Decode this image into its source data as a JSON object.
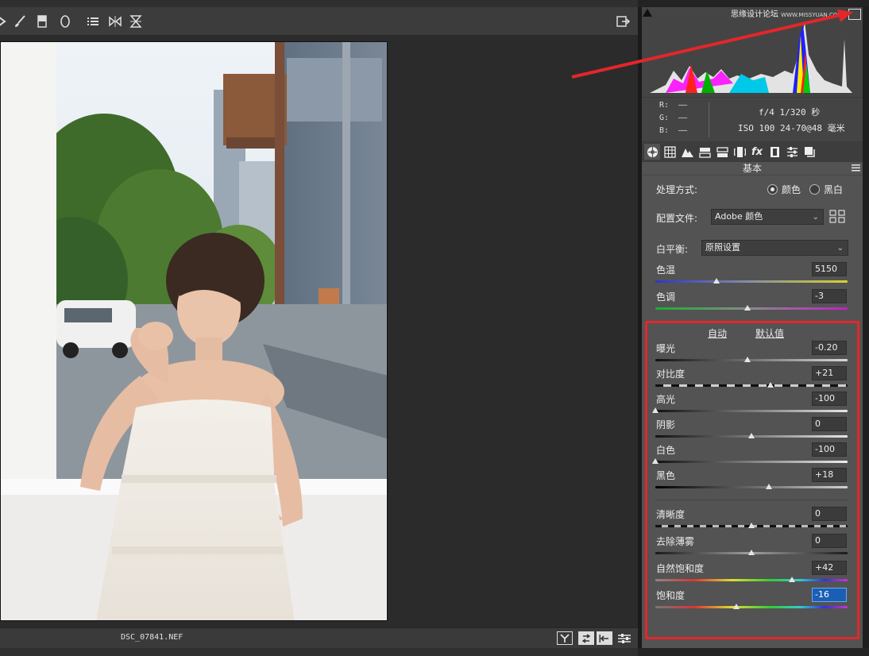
{
  "app": {
    "filename": "DSC_07841.NEF"
  },
  "histogram": {
    "watermark_text": "思缘设计论坛",
    "watermark_url": "WWW.MISSYUAN.COM"
  },
  "info": {
    "r_label": "R:",
    "g_label": "G:",
    "b_label": "B:",
    "r_value": "——",
    "g_value": "——",
    "b_value": "——",
    "exposure_line": "f/4  1/320 秒",
    "iso_line": "ISO 100  24-70@48 毫米"
  },
  "panel": {
    "section_title": "基本",
    "treatment_label": "处理方式:",
    "treatment_color": "颜色",
    "treatment_bw": "黑白",
    "profile_label": "配置文件:",
    "profile_value": "Adobe 颜色",
    "wb_label": "白平衡:",
    "wb_value": "原照设置",
    "auto_label": "自动",
    "default_label": "默认值"
  },
  "sliders": {
    "temperature": {
      "label": "色温",
      "value": "5150",
      "pos": 0.32
    },
    "tint": {
      "label": "色调",
      "value": "-3",
      "pos": 0.48
    },
    "exposure": {
      "label": "曝光",
      "value": "-0.20",
      "pos": 0.48
    },
    "contrast": {
      "label": "对比度",
      "value": "+21",
      "pos": 0.6
    },
    "highlights": {
      "label": "高光",
      "value": "-100",
      "pos": 0.0
    },
    "shadows": {
      "label": "阴影",
      "value": "0",
      "pos": 0.5
    },
    "whites": {
      "label": "白色",
      "value": "-100",
      "pos": 0.0
    },
    "blacks": {
      "label": "黑色",
      "value": "+18",
      "pos": 0.59
    },
    "clarity": {
      "label": "清晰度",
      "value": "0",
      "pos": 0.5
    },
    "dehaze": {
      "label": "去除薄雾",
      "value": "0",
      "pos": 0.5
    },
    "vibrance": {
      "label": "自然饱和度",
      "value": "+42",
      "pos": 0.71
    },
    "saturation": {
      "label": "饱和度",
      "value": "-16",
      "pos": 0.42
    }
  },
  "colors": {
    "annotation_red": "#e3262b",
    "panel_bg": "#535353",
    "canvas_bg": "#2b2b2b"
  },
  "icons": {
    "toolbar": [
      "straighten-icon",
      "brush-icon",
      "graduated-filter-icon",
      "radial-filter-icon",
      "list-icon",
      "flip-icon",
      "hourglass-icon",
      "export-icon"
    ],
    "tabs": [
      "aperture-icon",
      "grid-icon",
      "mountain-icon",
      "split-icon",
      "split-toning-icon",
      "lens-icon",
      "fx-icon",
      "filmstrip-icon",
      "sliders-icon",
      "presets-icon"
    ]
  }
}
